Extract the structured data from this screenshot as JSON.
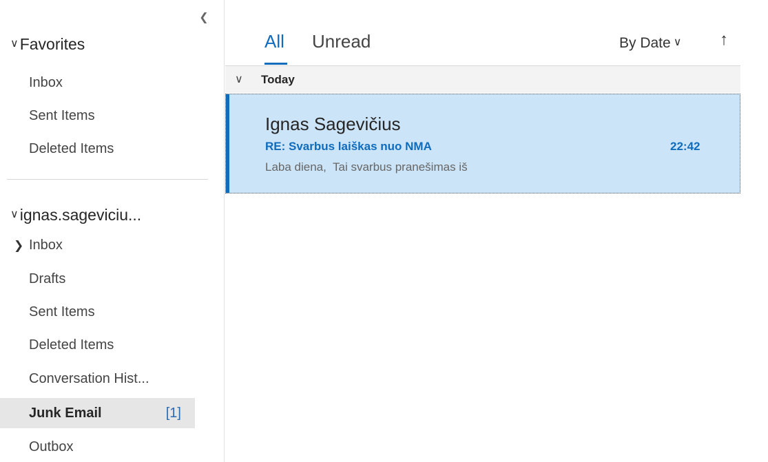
{
  "sidebar": {
    "collapse_icon": "chevron-left-icon",
    "favorites": {
      "label": "Favorites",
      "items": [
        {
          "label": "Inbox"
        },
        {
          "label": "Sent Items"
        },
        {
          "label": "Deleted Items"
        }
      ]
    },
    "account": {
      "label": "ignas.sageviciu...",
      "items": [
        {
          "label": "Inbox"
        },
        {
          "label": "Drafts"
        },
        {
          "label": "Sent Items"
        },
        {
          "label": "Deleted Items"
        },
        {
          "label": "Conversation Hist..."
        },
        {
          "label": "Junk Email",
          "count": "[1]"
        },
        {
          "label": "Outbox"
        }
      ]
    }
  },
  "list": {
    "tabs": [
      {
        "label": "All"
      },
      {
        "label": "Unread"
      }
    ],
    "sort_label": "By Date",
    "sort_direction_glyph": "↑",
    "group_label": "Today",
    "messages": [
      {
        "sender": "Ignas Sagevičius",
        "subject": "RE: Svarbus laiškas nuo NMA",
        "time": "22:42",
        "preview": "Laba diena,  Tai svarbus pranešimas iš"
      }
    ]
  },
  "colors": {
    "accent": "#0f6cbd",
    "selected_message_bg": "#cce4f7",
    "selected_folder_bg": "#e6e6e6"
  }
}
